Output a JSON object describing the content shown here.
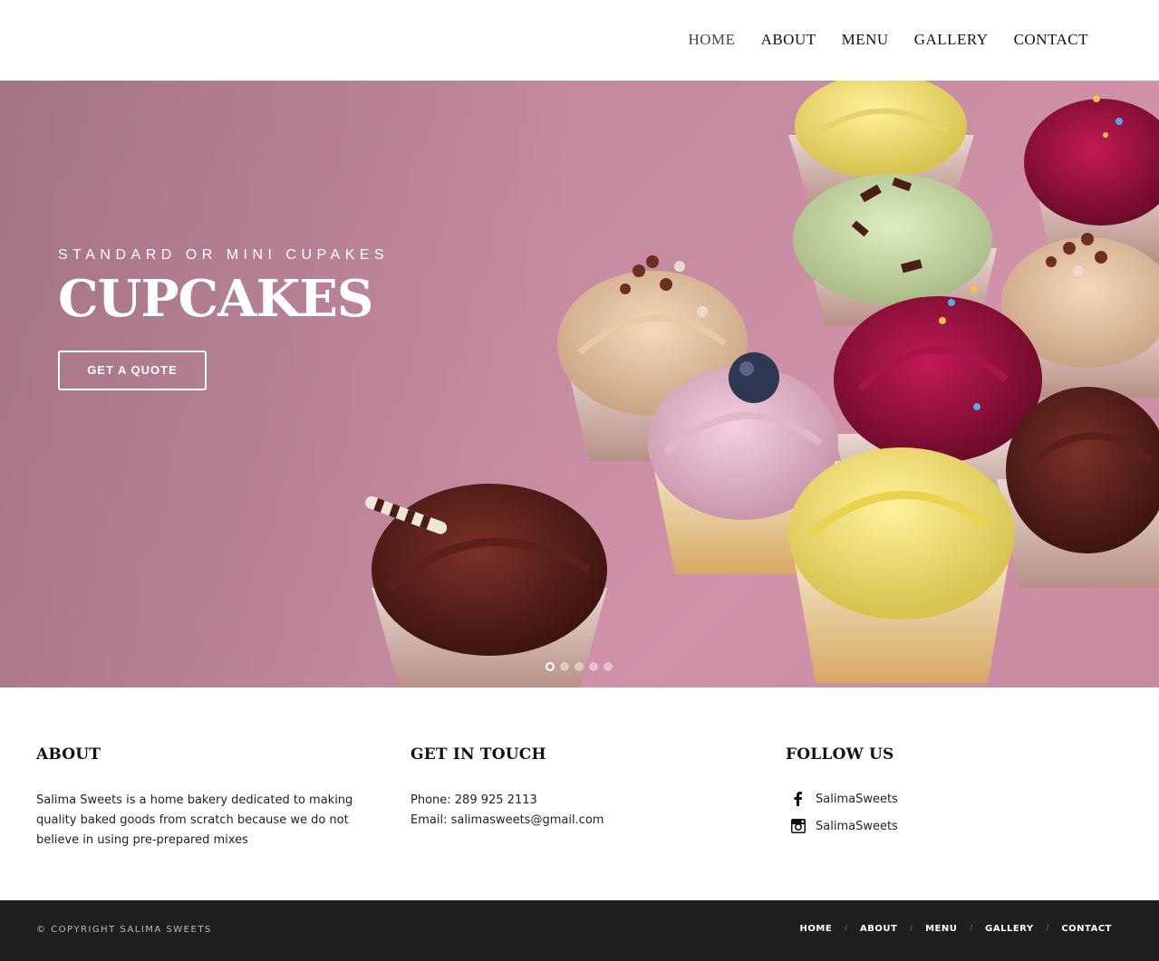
{
  "nav": {
    "items": [
      "HOME",
      "ABOUT",
      "MENU",
      "GALLERY",
      "CONTACT"
    ],
    "active": "HOME"
  },
  "hero": {
    "subtitle": "STANDARD OR MINI CUPAKES",
    "title": "CUPCAKES",
    "button": "GET A QUOTE",
    "slides": 5,
    "active_slide": 1,
    "bg_color": "#c48a9e"
  },
  "about": {
    "heading": "ABOUT",
    "text": "Salima Sweets is a home bakery dedicated to making quality baked goods from scratch because we do not believe in using pre-prepared mixes"
  },
  "contact": {
    "heading": "GET IN TOUCH",
    "phone": "Phone: 289 925 2113",
    "email": "Email: salimasweets@gmail.com"
  },
  "follow": {
    "heading": "FOLLOW US",
    "facebook": {
      "icon": "facebook-icon",
      "label": "SalimaSweets"
    },
    "instagram": {
      "icon": "instagram-icon",
      "label": "SalimaSweets"
    }
  },
  "footer": {
    "copyright": "© COPYRIGHT SALIMA SWEETS",
    "links": [
      "HOME",
      "ABOUT",
      "MENU",
      "GALLERY",
      "CONTACT"
    ],
    "separator": "/",
    "bg_color": "#1f1f1f"
  }
}
